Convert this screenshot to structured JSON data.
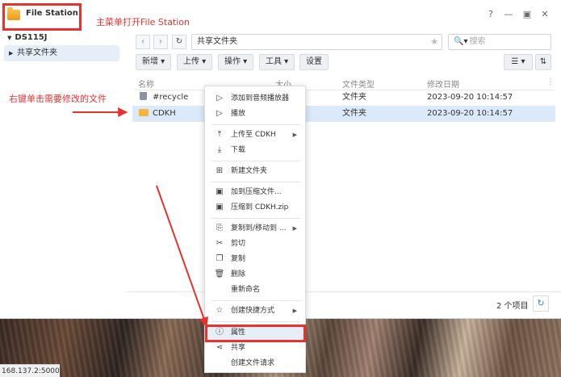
{
  "window": {
    "title": "File Station",
    "controls": [
      "?",
      "—",
      "▣",
      "✕"
    ]
  },
  "annotations": {
    "open_file_station": "主菜单打开File Station",
    "right_click_hint": "右键单击需要修改的文件"
  },
  "sidebar": {
    "root": "DS115J",
    "items": [
      {
        "label": "共享文件夹"
      }
    ]
  },
  "nav": {
    "path": "共享文件夹",
    "search_placeholder": "搜索"
  },
  "toolbar": {
    "new_label": "新增 ▾",
    "upload_label": "上传 ▾",
    "action_label": "操作 ▾",
    "tools_label": "工具 ▾",
    "settings_label": "设置"
  },
  "table": {
    "columns": [
      "名称",
      "大小",
      "文件类型",
      "修改日期"
    ],
    "rows": [
      {
        "name": "#recycle",
        "type": "文件夹",
        "modified": "2023-09-20 10:14:57",
        "icon": "trash-icon"
      },
      {
        "name": "CDKH",
        "type": "文件夹",
        "modified": "2023-09-20 10:14:57",
        "icon": "folder-icon"
      }
    ],
    "item_count": "2 个项目"
  },
  "context_menu": {
    "items": [
      {
        "label": "添加到音频播放器",
        "icon": "play-icon"
      },
      {
        "label": "播放",
        "icon": "play-icon"
      },
      {
        "label": "上传至 CDKH",
        "icon": "upload-icon"
      },
      {
        "label": "下载",
        "icon": "download-icon"
      },
      {
        "label": "新建文件夹",
        "icon": "new-folder-icon"
      },
      {
        "label": "加到压缩文件...",
        "icon": "archive-icon"
      },
      {
        "label": "压缩到 CDKH.zip",
        "icon": "archive-icon"
      },
      {
        "label": "复制到/移动到 ...",
        "icon": "copy-move-icon"
      },
      {
        "label": "剪切",
        "icon": "scissors-icon"
      },
      {
        "label": "复制",
        "icon": "copy-icon"
      },
      {
        "label": "删除",
        "icon": "trash-icon"
      },
      {
        "label": "重新命名",
        "icon": ""
      },
      {
        "label": "创建快捷方式",
        "icon": "star-icon"
      },
      {
        "label": "属性",
        "icon": "info-icon"
      },
      {
        "label": "共享",
        "icon": "share-icon"
      },
      {
        "label": "创建文件请求",
        "icon": ""
      }
    ]
  },
  "status_url": "168.137.2:5000/#",
  "colors": {
    "annotation_red": "#e8322e",
    "selection_blue": "#dbeaf8",
    "accent_blue": "#3b86d4"
  }
}
